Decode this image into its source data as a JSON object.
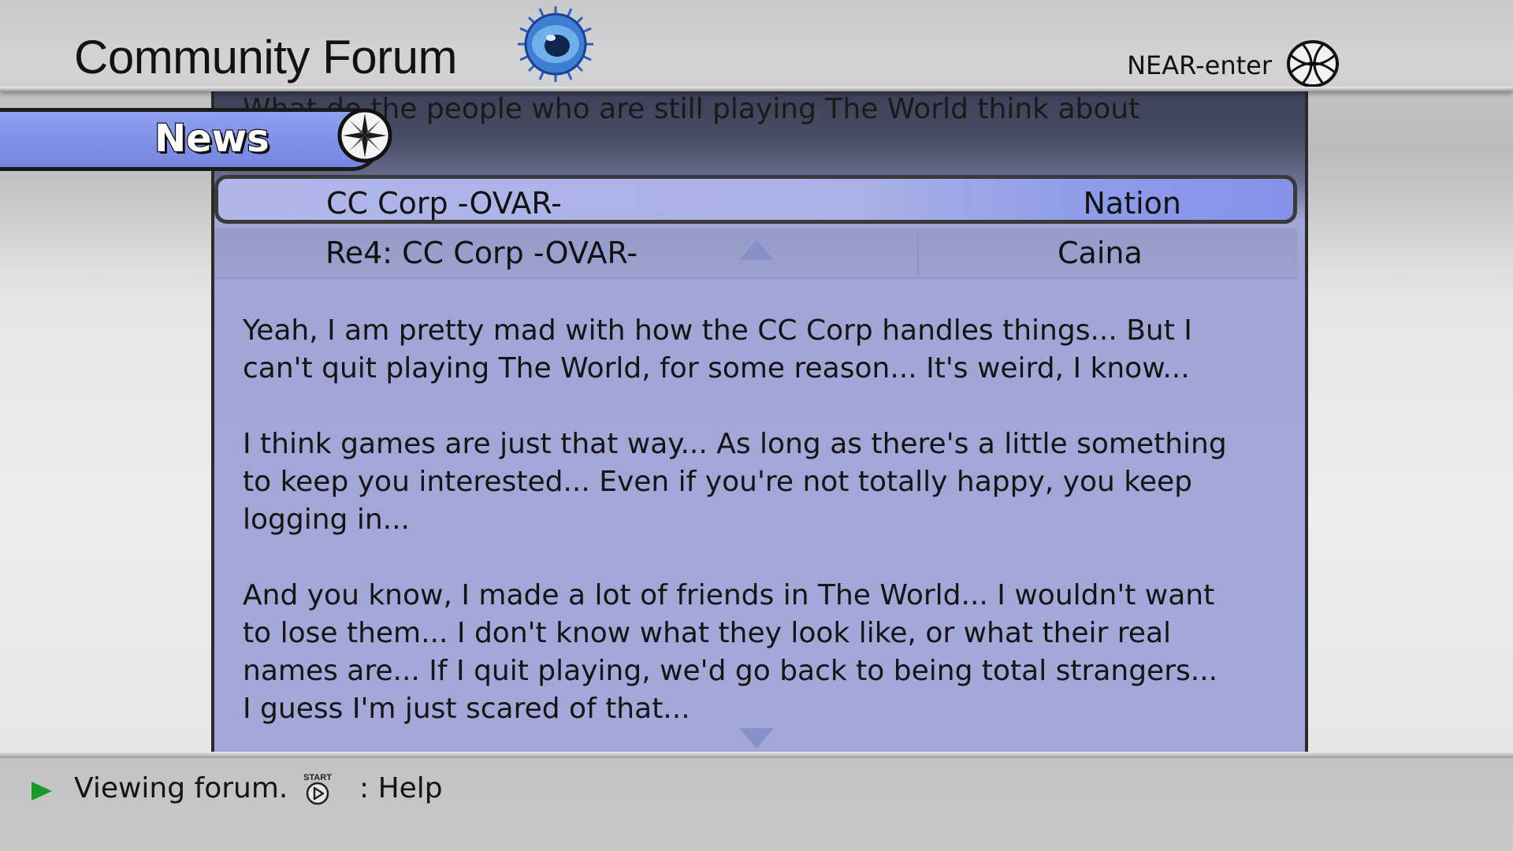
{
  "header": {
    "title": "Community Forum",
    "near_label": "NEAR-enter",
    "emblem_icon": "blue-eye-emblem-icon",
    "globe_icon": "globe-icon"
  },
  "tab": {
    "label": "News",
    "icon": "compass-icon",
    "color": "#8495ea"
  },
  "forum": {
    "intro_text": "What do the people who are still playing The World think about",
    "selected_thread": {
      "subject": "CC Corp -OVAR-",
      "author": "Nation"
    },
    "reply": {
      "subject": "Re4: CC Corp -OVAR-",
      "author": "Caina"
    },
    "body": [
      "Yeah, I am pretty mad with how the CC Corp handles things... But I can't quit playing The World, for some reason... It's weird, I know...",
      "I think games are just that way... As long as there's a little something to keep you interested... Even if you're not totally happy, you keep logging in...",
      "And you know, I made a lot of friends in The World... I wouldn't want to lose them... I don't know what they look like, or what their real names are... If I quit playing, we'd go back to being total strangers... I guess I'm just scared of that..."
    ],
    "panel_color": "#a3a8d8"
  },
  "footer": {
    "status": "Viewing forum.",
    "start_badge": "START",
    "help": ": Help",
    "play_color": "#1a9a2a"
  }
}
